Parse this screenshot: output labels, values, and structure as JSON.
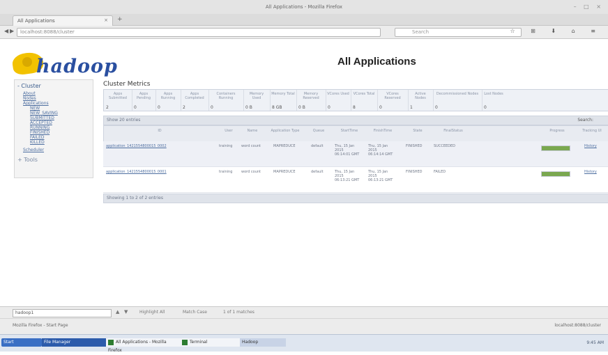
{
  "window": {
    "title": "All Applications - Mozilla Firefox",
    "controls": "– □ ×"
  },
  "tab": {
    "label": "All Applications",
    "close": "×",
    "new": "+"
  },
  "nav": {
    "back": "◀",
    "forward": "▶",
    "url": "localhost:8088/cluster",
    "search_placeholder": "Search",
    "toolbar_icons": "☆ ⊞ ⬇ ⌂ ≡"
  },
  "header": {
    "logo_text": "hadoop",
    "page_title": "All Applications"
  },
  "sidebar": {
    "cluster": "- Cluster",
    "links": [
      "About",
      "Nodes",
      "Applications",
      "NEW",
      "NEW_SAVING",
      "SUBMITTED",
      "ACCEPTED",
      "RUNNING",
      "FINISHED",
      "FAILED",
      "KILLED",
      "Scheduler"
    ],
    "tools": "+ Tools"
  },
  "metrics": {
    "title": "Cluster Metrics",
    "headers": [
      "Apps Submitted",
      "Apps Pending",
      "Apps Running",
      "Apps Completed",
      "Containers Running",
      "Memory Used",
      "Memory Total",
      "Memory Reserved",
      "VCores Used",
      "VCores Total",
      "VCores Reserved",
      "Active Nodes",
      "Decommissioned Nodes",
      "Lost Nodes"
    ],
    "values": [
      "2",
      "0",
      "0",
      "2",
      "0",
      "0 B",
      "8 GB",
      "0 B",
      "0",
      "8",
      "0",
      "1",
      "0",
      "0"
    ]
  },
  "table": {
    "show_label": "Show 20 entries",
    "search_label": "Search:",
    "headers": [
      "ID",
      "User",
      "Name",
      "Application Type",
      "Queue",
      "StartTime",
      "FinishTime",
      "State",
      "FinalStatus",
      "Progress",
      "Tracking UI"
    ],
    "rows": [
      {
        "id": "application_1421554800015_0002",
        "user": "training",
        "name": "word count",
        "type": "MAPREDUCE",
        "queue": "default",
        "start": "Thu, 15 Jan 2015 06:14:01 GMT",
        "finish": "Thu, 15 Jan 2015 06:14:14 GMT",
        "state": "FINISHED",
        "final": "SUCCEEDED",
        "progress": 1.0,
        "tracking": "History"
      },
      {
        "id": "application_1421554800015_0001",
        "user": "training",
        "name": "word count",
        "type": "MAPREDUCE",
        "queue": "default",
        "start": "Thu, 15 Jan 2015 06:13:21 GMT",
        "finish": "Thu, 15 Jan 2015 06:13:21 GMT",
        "state": "FINISHED",
        "final": "FAILED",
        "progress": 1.0,
        "tracking": "History"
      }
    ],
    "footer": "Showing 1 to 2 of 2 entries"
  },
  "findbar": {
    "value": "hadoop1",
    "prev": "▲",
    "next": "▼",
    "highlight": "Highlight All",
    "match_case": "Match Case",
    "status": "1 of 1 matches"
  },
  "status": {
    "left": "Mozilla Firefox - Start Page",
    "right": "localhost:8088/cluster"
  },
  "taskbar": {
    "start": "Start",
    "items": [
      "File Manager",
      "All Applications - Mozilla Firefox",
      "Terminal",
      "Hadoop"
    ],
    "tray": "9:45 AM"
  },
  "colors": {
    "accent": "#2a4fa0",
    "logo_yellow": "#f2c200",
    "progress": "#7aa84f"
  }
}
